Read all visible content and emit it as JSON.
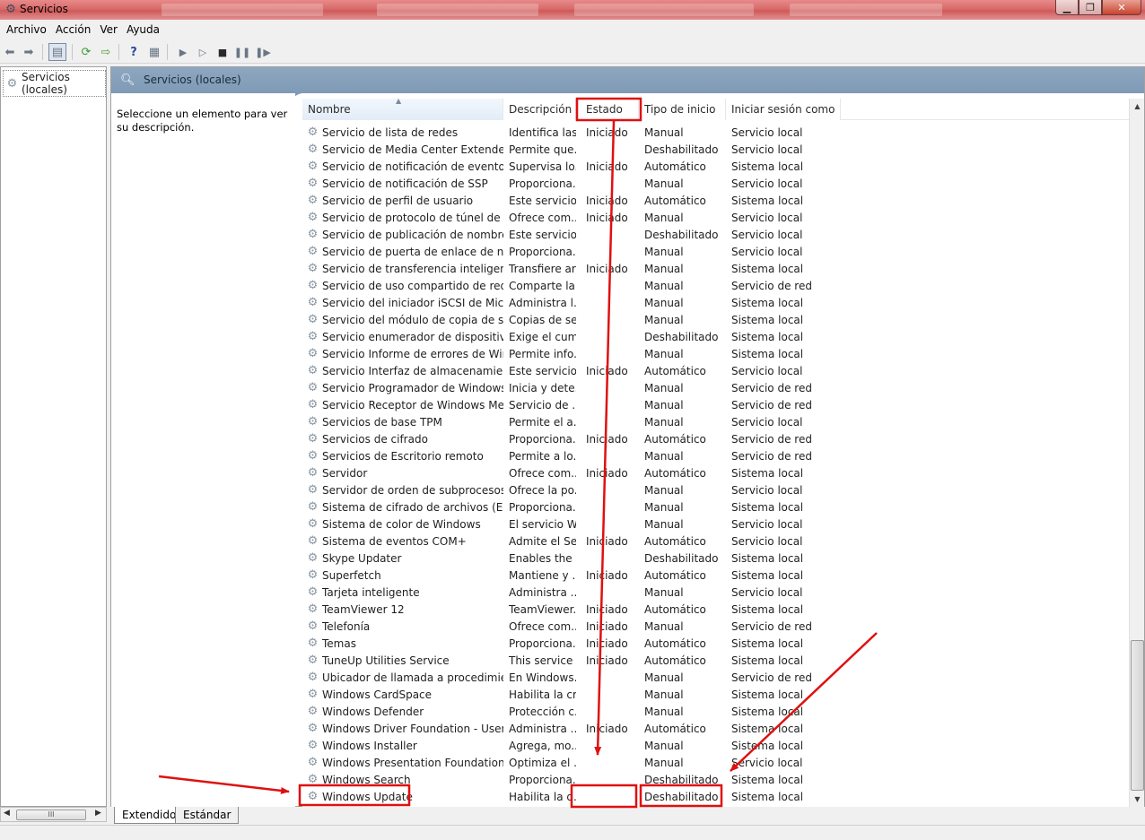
{
  "window": {
    "title": "Servicios"
  },
  "menu": [
    "Archivo",
    "Acción",
    "Ver",
    "Ayuda"
  ],
  "tree": {
    "root_label": "Servicios (locales)"
  },
  "main_header": {
    "title": "Servicios (locales)"
  },
  "description_pane": {
    "text": "Seleccione un elemento para ver su descripción."
  },
  "columns": [
    {
      "key": "name",
      "label": "Nombre"
    },
    {
      "key": "description",
      "label": "Descripción"
    },
    {
      "key": "status",
      "label": "Estado"
    },
    {
      "key": "startup",
      "label": "Tipo de inicio"
    },
    {
      "key": "logon",
      "label": "Iniciar sesión como"
    }
  ],
  "services": [
    [
      "Servicio de lista de redes",
      "Identifica las...",
      "Iniciado",
      "Manual",
      "Servicio local"
    ],
    [
      "Servicio de Media Center Extender",
      "Permite que...",
      "",
      "Deshabilitado",
      "Servicio local"
    ],
    [
      "Servicio de notificación de eventos ...",
      "Supervisa lo...",
      "Iniciado",
      "Automático",
      "Sistema local"
    ],
    [
      "Servicio de notificación de SSP",
      "Proporciona...",
      "",
      "Manual",
      "Servicio local"
    ],
    [
      "Servicio de perfil de usuario",
      "Este servicio...",
      "Iniciado",
      "Automático",
      "Sistema local"
    ],
    [
      "Servicio de protocolo de túnel de so...",
      "Ofrece com...",
      "Iniciado",
      "Manual",
      "Servicio local"
    ],
    [
      "Servicio de publicación de nombres ...",
      "Este servicio...",
      "",
      "Deshabilitado",
      "Servicio local"
    ],
    [
      "Servicio de puerta de enlace de nivel...",
      "Proporciona...",
      "",
      "Manual",
      "Servicio local"
    ],
    [
      "Servicio de transferencia inteligente ...",
      "Transfiere ar...",
      "Iniciado",
      "Manual",
      "Sistema local"
    ],
    [
      "Servicio de uso compartido de red d...",
      "Comparte la...",
      "",
      "Manual",
      "Servicio de red"
    ],
    [
      "Servicio del iniciador iSCSI de Micro...",
      "Administra l...",
      "",
      "Manual",
      "Sistema local"
    ],
    [
      "Servicio del módulo de copia de seg...",
      "Copias de se...",
      "",
      "Manual",
      "Sistema local"
    ],
    [
      "Servicio enumerador de dispositivos...",
      "Exige el cum...",
      "",
      "Deshabilitado",
      "Sistema local"
    ],
    [
      "Servicio Informe de errores de Wind...",
      "Permite info...",
      "",
      "Manual",
      "Sistema local"
    ],
    [
      "Servicio Interfaz de almacenamiento...",
      "Este servicio...",
      "Iniciado",
      "Automático",
      "Servicio local"
    ],
    [
      "Servicio Programador de Windows ...",
      "Inicia y dete...",
      "",
      "Manual",
      "Servicio de red"
    ],
    [
      "Servicio Receptor de Windows Medi...",
      "Servicio de ...",
      "",
      "Manual",
      "Servicio de red"
    ],
    [
      "Servicios de base TPM",
      "Permite el a...",
      "",
      "Manual",
      "Servicio local"
    ],
    [
      "Servicios de cifrado",
      "Proporciona...",
      "Iniciado",
      "Automático",
      "Servicio de red"
    ],
    [
      "Servicios de Escritorio remoto",
      "Permite a lo...",
      "",
      "Manual",
      "Servicio de red"
    ],
    [
      "Servidor",
      "Ofrece com...",
      "Iniciado",
      "Automático",
      "Sistema local"
    ],
    [
      "Servidor de orden de subprocesos",
      "Ofrece la po...",
      "",
      "Manual",
      "Servicio local"
    ],
    [
      "Sistema de cifrado de archivos (EFS)",
      "Proporciona...",
      "",
      "Manual",
      "Sistema local"
    ],
    [
      "Sistema de color de Windows",
      "El servicio W...",
      "",
      "Manual",
      "Servicio local"
    ],
    [
      "Sistema de eventos COM+",
      "Admite el Se...",
      "Iniciado",
      "Automático",
      "Servicio local"
    ],
    [
      "Skype Updater",
      "Enables the ...",
      "",
      "Deshabilitado",
      "Sistema local"
    ],
    [
      "Superfetch",
      "Mantiene y ...",
      "Iniciado",
      "Automático",
      "Sistema local"
    ],
    [
      "Tarjeta inteligente",
      "Administra ...",
      "",
      "Manual",
      "Servicio local"
    ],
    [
      "TeamViewer 12",
      "TeamViewer...",
      "Iniciado",
      "Automático",
      "Sistema local"
    ],
    [
      "Telefonía",
      "Ofrece com...",
      "Iniciado",
      "Manual",
      "Servicio de red"
    ],
    [
      "Temas",
      "Proporciona...",
      "Iniciado",
      "Automático",
      "Sistema local"
    ],
    [
      "TuneUp Utilities Service",
      "This service ...",
      "Iniciado",
      "Automático",
      "Sistema local"
    ],
    [
      "Ubicador de llamada a procedimient...",
      "En Windows...",
      "",
      "Manual",
      "Servicio de red"
    ],
    [
      "Windows CardSpace",
      "Habilita la cr...",
      "",
      "Manual",
      "Sistema local"
    ],
    [
      "Windows Defender",
      "Protección c...",
      "",
      "Manual",
      "Sistema local"
    ],
    [
      "Windows Driver Foundation - User-...",
      "Administra ...",
      "Iniciado",
      "Automático",
      "Sistema local"
    ],
    [
      "Windows Installer",
      "Agrega, mo...",
      "",
      "Manual",
      "Sistema local"
    ],
    [
      "Windows Presentation Foundation F...",
      "Optimiza el ...",
      "",
      "Manual",
      "Servicio local"
    ],
    [
      "Windows Search",
      "Proporciona...",
      "",
      "Deshabilitado",
      "Sistema local"
    ],
    [
      "Windows Update",
      "Habilita la d...",
      "",
      "Deshabilitado",
      "Sistema local"
    ]
  ],
  "tabs": [
    "Extendido",
    "Estándar"
  ],
  "tree_scroll_thumb": "III",
  "annotation_color": "#e01010",
  "icons": {
    "service": "gear-icon",
    "app": "services-icon"
  }
}
